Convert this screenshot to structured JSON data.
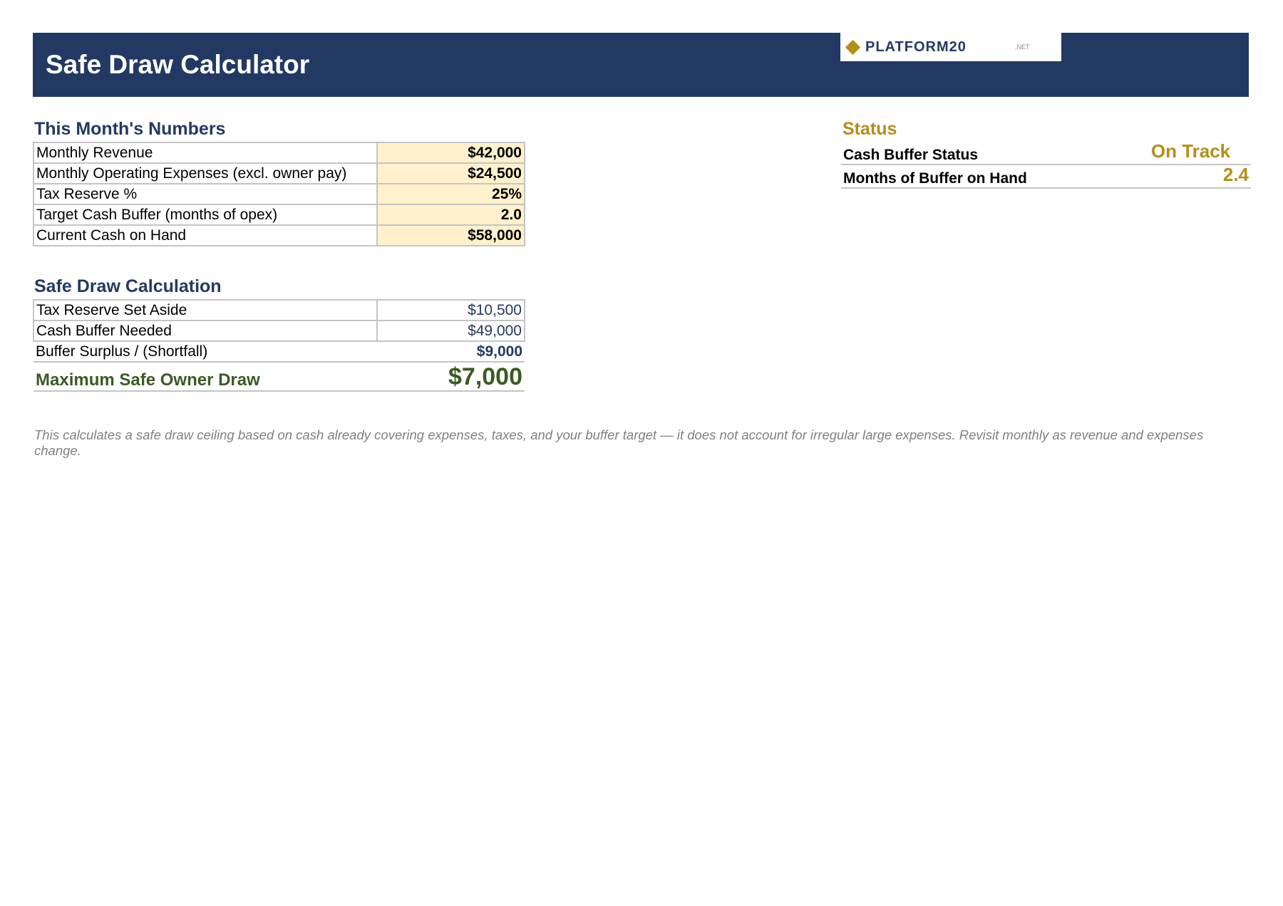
{
  "header": {
    "title": "Safe Draw Calculator",
    "logo_text": "PLATFORM20",
    "logo_suffix": ".NET",
    "colors": {
      "header_bg": "#223a63",
      "accent_gold": "#b58e1a",
      "input_fill": "#fff1cc",
      "result_green": "#3c5a22"
    }
  },
  "inputs": {
    "title": "This Month's Numbers",
    "rows": [
      {
        "label": "Monthly Revenue",
        "value": "$42,000"
      },
      {
        "label": "Monthly Operating Expenses (excl. owner pay)",
        "value": "$24,500"
      },
      {
        "label": "Tax Reserve %",
        "value": "25%"
      },
      {
        "label": "Target Cash Buffer (months of opex)",
        "value": "2.0"
      },
      {
        "label": "Current Cash on Hand",
        "value": "$58,000"
      }
    ]
  },
  "calculation": {
    "title": "Safe Draw Calculation",
    "rows": [
      {
        "label": "Tax Reserve Set Aside",
        "value": "$10,500"
      },
      {
        "label": "Cash Buffer Needed",
        "value": "$49,000"
      },
      {
        "label": "Buffer Surplus / (Shortfall)",
        "value": "$9,000"
      }
    ],
    "result": {
      "label": "Maximum Safe Owner Draw",
      "value": "$7,000"
    }
  },
  "status": {
    "title": "Status",
    "rows": [
      {
        "label": "Cash Buffer Status",
        "value": "On Track"
      },
      {
        "label": "Months of Buffer on Hand",
        "value": "2.4"
      }
    ]
  },
  "footnote": "This calculates a safe draw ceiling based on cash already covering expenses, taxes, and your buffer target — it does not account for irregular large expenses. Revisit monthly as revenue and expenses change."
}
